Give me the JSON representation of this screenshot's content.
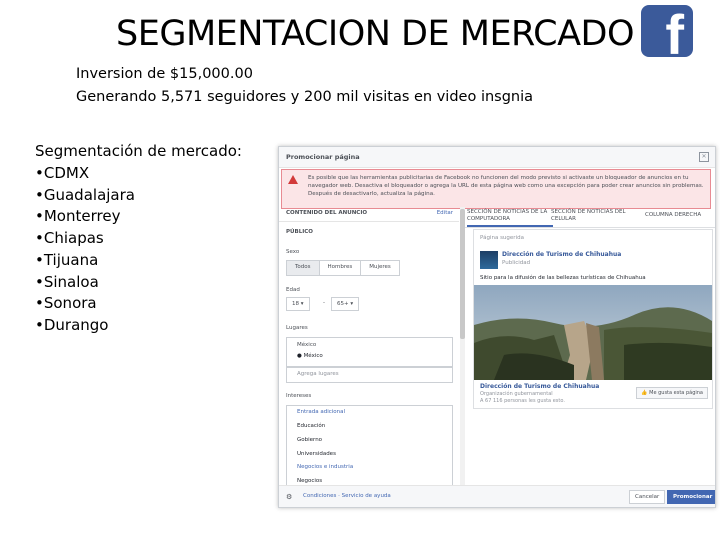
{
  "slide": {
    "title": "SEGMENTACION DE MERCADO",
    "logo_letter": "f",
    "line1": "Inversion de $15,000.00",
    "line2": "Generando 5,571 seguidores y 200 mil visitas en video insgnia",
    "seg_title": "Segmentación de mercado:",
    "cities": [
      "CDMX",
      "Guadalajara",
      "Monterrey",
      "Chiapas",
      "Tijuana",
      "Sinaloa",
      "Sonora",
      "Durango"
    ]
  },
  "dialog": {
    "title": "Promocionar página",
    "close_icon": "close-icon",
    "warning": "Es posible que las herramientas publicitarias de Facebook no funcionen del modo previsto si activaste un bloqueador de anuncios en tu navegador web. Desactiva el bloqueador o agrega la URL de esta página web como una excepción para poder crear anuncios sin problemas. Después de desactivarlo, actualiza la página.",
    "left_header": "CONTENIDO DEL ANUNCIO",
    "edit": "Editar",
    "audience": "PÚBLICO",
    "sexo_label": "Sexo",
    "sexo_options": [
      "Todos",
      "Hombres",
      "Mujeres"
    ],
    "edad_label": "Edad",
    "age_from": "18",
    "age_to": "65+",
    "lugares_label": "Lugares",
    "country": "México",
    "location": "México",
    "add_location_placeholder": "Agrega lugares",
    "interests_label": "Intereses",
    "interests_section1": "Entrada adicional",
    "interests": [
      "Educación",
      "Gobierno",
      "Universidades"
    ],
    "interests_section2": "Negocios e industria",
    "interests_more": "Negocios",
    "tabs": [
      "SECCIÓN DE NOTICIAS DE LA COMPUTADORA",
      "SECCIÓN DE NOTICIAS DEL CELULAR",
      "COLUMNA DERECHA"
    ],
    "preview": {
      "suggested": "Página sugerida",
      "page_name": "Dirección de Turismo de Chihuahua",
      "sponsored": "Publicidad",
      "description": "Sitio para la difusión de las bellezas turísticas de Chihuahua",
      "name2": "Dirección de Turismo de Chihuahua",
      "category": "Organización gubernamental",
      "likes": "A 67 116 personas les gusta esto.",
      "like_button": "Me gusta esta página"
    },
    "footer": {
      "links": "Condiciones · Servicio de ayuda",
      "cancel": "Cancelar",
      "promote": "Promocionar"
    }
  },
  "colors": {
    "facebook_blue": "#3b5a9a",
    "button_blue": "#4267b2",
    "warning_bg": "#fbe5e7"
  }
}
